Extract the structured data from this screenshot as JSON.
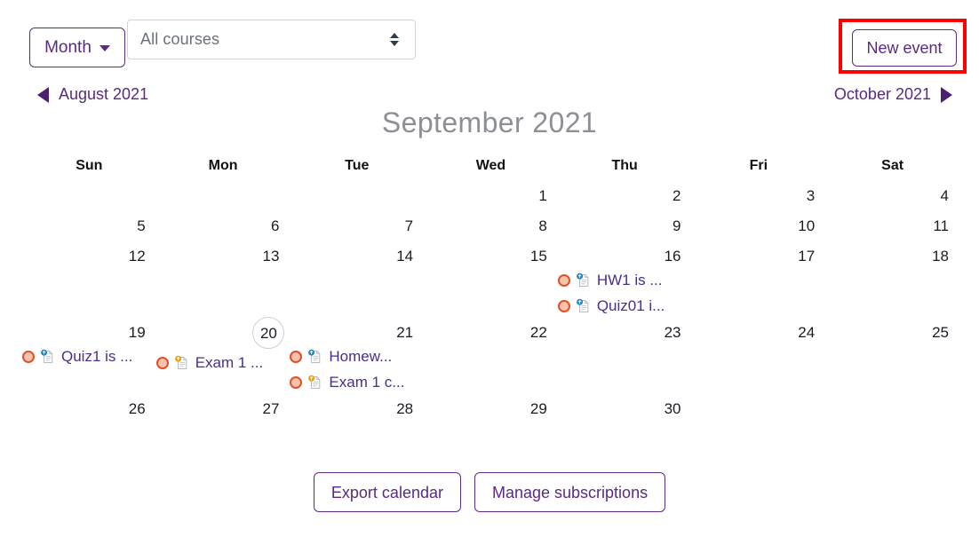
{
  "toolbar": {
    "view_selector_label": "Month",
    "course_filter_value": "All courses",
    "course_filter_placeholder": "All courses",
    "new_event_label": "New event",
    "highlight_color": "#ff0000",
    "accent_color": "#5a2a82"
  },
  "nav": {
    "prev_label": "August 2021",
    "next_label": "October 2021",
    "current_month_title": "September 2021"
  },
  "calendar": {
    "weekdays": [
      "Sun",
      "Mon",
      "Tue",
      "Wed",
      "Thu",
      "Fri",
      "Sat"
    ],
    "today": 20,
    "weeks": [
      [
        {
          "day": "",
          "events": []
        },
        {
          "day": "",
          "events": []
        },
        {
          "day": "",
          "events": []
        },
        {
          "day": "1",
          "events": []
        },
        {
          "day": "2",
          "events": []
        },
        {
          "day": "3",
          "events": []
        },
        {
          "day": "4",
          "events": []
        }
      ],
      [
        {
          "day": "5",
          "events": []
        },
        {
          "day": "6",
          "events": []
        },
        {
          "day": "7",
          "events": []
        },
        {
          "day": "8",
          "events": []
        },
        {
          "day": "9",
          "events": []
        },
        {
          "day": "10",
          "events": []
        },
        {
          "day": "11",
          "events": []
        }
      ],
      [
        {
          "day": "12",
          "events": []
        },
        {
          "day": "13",
          "events": []
        },
        {
          "day": "14",
          "events": []
        },
        {
          "day": "15",
          "events": []
        },
        {
          "day": "16",
          "events": [
            {
              "title": "HW1 is ...",
              "icon": "assignment-icon",
              "badge_color": "#1a86d0"
            },
            {
              "title": "Quiz01 i...",
              "icon": "assignment-icon",
              "badge_color": "#1a86d0"
            }
          ]
        },
        {
          "day": "17",
          "events": []
        },
        {
          "day": "18",
          "events": []
        }
      ],
      [
        {
          "day": "19",
          "events": [
            {
              "title": "Quiz1 is ...",
              "icon": "assignment-icon",
              "badge_color": "#1a86d0"
            }
          ]
        },
        {
          "day": "20",
          "events": [
            {
              "title": "Exam 1 ...",
              "icon": "quiz-icon",
              "badge_color": "#f0a000"
            }
          ]
        },
        {
          "day": "21",
          "events": [
            {
              "title": "Homew...",
              "icon": "assignment-icon",
              "badge_color": "#1a86d0"
            },
            {
              "title": "Exam 1 c...",
              "icon": "quiz-icon",
              "badge_color": "#f0a000"
            }
          ]
        },
        {
          "day": "22",
          "events": []
        },
        {
          "day": "23",
          "events": []
        },
        {
          "day": "24",
          "events": []
        },
        {
          "day": "25",
          "events": []
        }
      ],
      [
        {
          "day": "26",
          "events": []
        },
        {
          "day": "27",
          "events": []
        },
        {
          "day": "28",
          "events": []
        },
        {
          "day": "29",
          "events": []
        },
        {
          "day": "30",
          "events": []
        },
        {
          "day": "",
          "events": []
        },
        {
          "day": "",
          "events": []
        }
      ]
    ]
  },
  "footer": {
    "export_label": "Export calendar",
    "manage_label": "Manage subscriptions"
  }
}
